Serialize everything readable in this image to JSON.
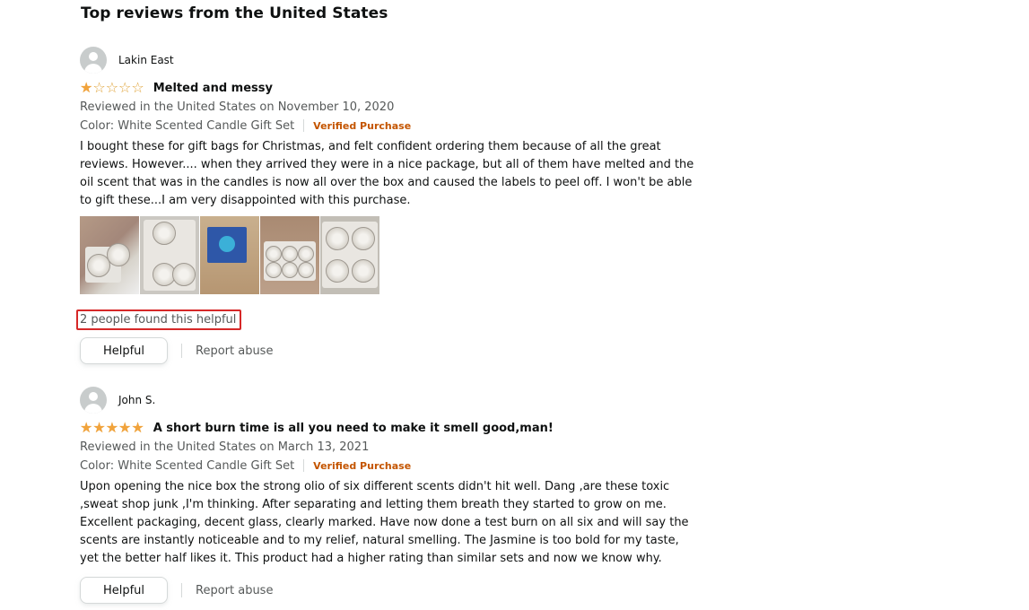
{
  "section": {
    "title": "Top reviews from the United States"
  },
  "reviews": [
    {
      "reviewer": "Lakin East",
      "rating": 1,
      "stars_glyph": "★★★★★",
      "title": "Melted and messy",
      "date_line": "Reviewed in the United States on November 10, 2020",
      "variant": "Color: White Scented Candle Gift Set",
      "verified": "Verified Purchase",
      "body": "I bought these for gift bags for Christmas, and felt confident ordering them because of all the great reviews. However.... when they arrived they were in a nice package, but all of them have melted and the oil scent that was in the candles is now all over the box and caused the labels to peel off. I won't be able to gift these...I am very disappointed with this purchase.",
      "images": [
        "review-photo-1",
        "review-photo-2",
        "review-photo-3",
        "review-photo-4",
        "review-photo-5"
      ],
      "helpful_count": "2 people found this helpful",
      "helpful_button": "Helpful",
      "report": "Report abuse"
    },
    {
      "reviewer": "John S.",
      "rating": 5,
      "stars_glyph": "★★★★★",
      "title": "A short burn time is all you need to make it smell good,man!",
      "date_line": "Reviewed in the United States on March 13, 2021",
      "variant": "Color: White Scented Candle Gift Set",
      "verified": "Verified Purchase",
      "body": "Upon opening the nice box the strong olio of six different scents didn't hit well. Dang ,are these toxic ,sweat shop junk ,I'm thinking. After separating and letting them breath they started to grow on me. Excellent packaging, decent glass, clearly marked. Have now done a test burn on all six and will say the scents are instantly noticeable and to my relief, natural smelling. The Jasmine is too bold for my taste, yet the better half likes it. This product had a higher rating than similar sets and now we know why.",
      "helpful_button": "Helpful",
      "report": "Report abuse"
    }
  ],
  "colors": {
    "star": "#f1a33c",
    "verified": "#c45500",
    "highlight_box": "#d62828"
  },
  "icons": {
    "avatar": "user-avatar-icon",
    "star": "star-icon"
  }
}
